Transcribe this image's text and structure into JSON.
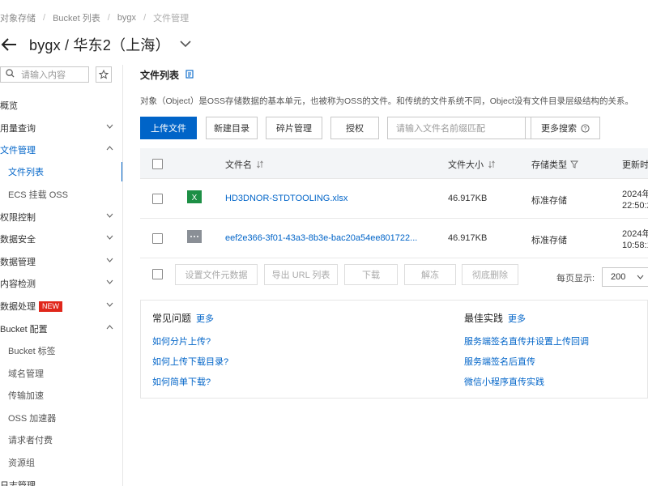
{
  "breadcrumb": [
    "对象存储",
    "Bucket 列表",
    "bygx",
    "文件管理"
  ],
  "header": {
    "title": "bygx / 华东2（上海）"
  },
  "sidebar": {
    "search_placeholder": "请输入内容",
    "items": [
      {
        "label": "概览"
      },
      {
        "label": "用量查询"
      },
      {
        "label": "文件管理"
      },
      {
        "label": "文件列表"
      },
      {
        "label": "ECS 挂载 OSS"
      },
      {
        "label": "权限控制"
      },
      {
        "label": "数据安全"
      },
      {
        "label": "数据管理"
      },
      {
        "label": "内容检测"
      },
      {
        "label": "数据处理",
        "badge": "NEW"
      },
      {
        "label": "Bucket 配置"
      },
      {
        "label": "Bucket 标签"
      },
      {
        "label": "域名管理"
      },
      {
        "label": "传输加速"
      },
      {
        "label": "OSS 加速器"
      },
      {
        "label": "请求者付费"
      },
      {
        "label": "资源组"
      },
      {
        "label": "日志管理"
      }
    ]
  },
  "main": {
    "section_title": "文件列表",
    "description": "对象（Object）是OSS存储数据的基本单元，也被称为OSS的文件。和传统的文件系统不同，Object没有文件目录层级结构的关系。",
    "toolbar": {
      "upload": "上传文件",
      "new_dir": "新建目录",
      "fragments": "碎片管理",
      "authorize": "授权",
      "search_placeholder": "请输入文件名前缀匹配",
      "more_search": "更多搜索"
    },
    "table": {
      "headers": {
        "name": "文件名",
        "size": "文件大小",
        "storage": "存储类型",
        "updated": "更新时"
      },
      "rows": [
        {
          "name": "HD3DNOR-STDTOOLING.xlsx",
          "size": "46.917KB",
          "storage": "标准存储",
          "date": "2024年",
          "time": "22:50:2",
          "icon": "excel-file-icon"
        },
        {
          "name": "eef2e366-3f01-43a3-8b3e-bac20a54ee801722...",
          "size": "46.917KB",
          "storage": "标准存储",
          "date": "2024年",
          "time": "10:58:1",
          "icon": "generic-file-icon"
        }
      ]
    },
    "batch": {
      "set_meta": "设置文件元数据",
      "export_url": "导出 URL 列表",
      "download": "下载",
      "unfreeze": "解冻",
      "delete": "彻底删除",
      "per_page_label": "每页显示:",
      "per_page_value": "200"
    },
    "faq": {
      "title": "常见问题",
      "more": "更多",
      "links": [
        "如何分片上传?",
        "如何上传下载目录?",
        "如何简单下载?"
      ]
    },
    "best": {
      "title": "最佳实践",
      "more": "更多",
      "links": [
        "服务端签名直传并设置上传回调",
        "服务端签名后直传",
        "微信小程序直传实践"
      ]
    }
  },
  "colors": {
    "primary": "#0064c8",
    "badge": "#e0271b",
    "excel": "#1d8f45"
  }
}
